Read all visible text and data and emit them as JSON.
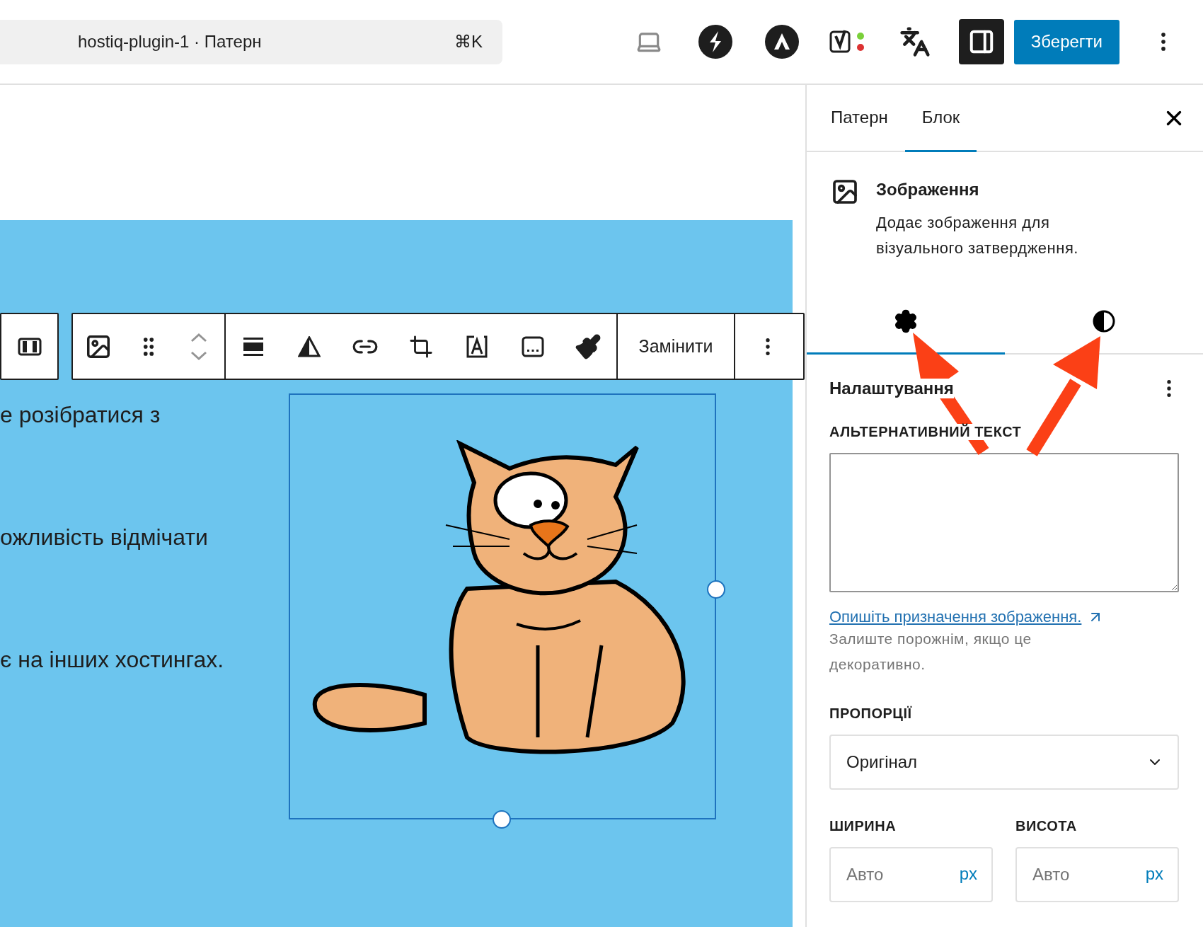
{
  "top_bar": {
    "command_search": {
      "title": "hostiq-plugin-1 · Патерн",
      "shortcut": "⌘K"
    },
    "sidebar_toggle": {
      "on": true
    },
    "save_button": "Зберегти"
  },
  "block_toolbar": {
    "replace_button": "Замінити"
  },
  "canvas": {
    "paragraphs": [
      "е розібратися з",
      "ожливість відмічати",
      "є на інших хостингах."
    ]
  },
  "sidebar": {
    "tabs": [
      {
        "label": "Патерн",
        "selected": false
      },
      {
        "label": "Блок",
        "selected": true
      }
    ],
    "block": {
      "title": "Зображення",
      "description": "Додає зображення для візуального затвердження."
    },
    "subtabs": [
      {
        "kind": "settings",
        "selected": true
      },
      {
        "kind": "styles",
        "selected": false
      }
    ],
    "panel": {
      "title": "Налаштування",
      "alt_text": {
        "label": "АЛЬТЕРНАТИВНИЙ ТЕКСТ",
        "link": "Опишіть призначення зображення.",
        "help": "Залиште порожнім, якщо це декоративно."
      },
      "aspect": {
        "label": "ПРОПОРЦІЇ",
        "value": "Оригінал"
      },
      "width": {
        "label": "ШИРИНА",
        "placeholder": "Авто",
        "unit": "px"
      },
      "height": {
        "label": "ВИСОТА",
        "placeholder": "Авто",
        "unit": "px"
      }
    }
  }
}
